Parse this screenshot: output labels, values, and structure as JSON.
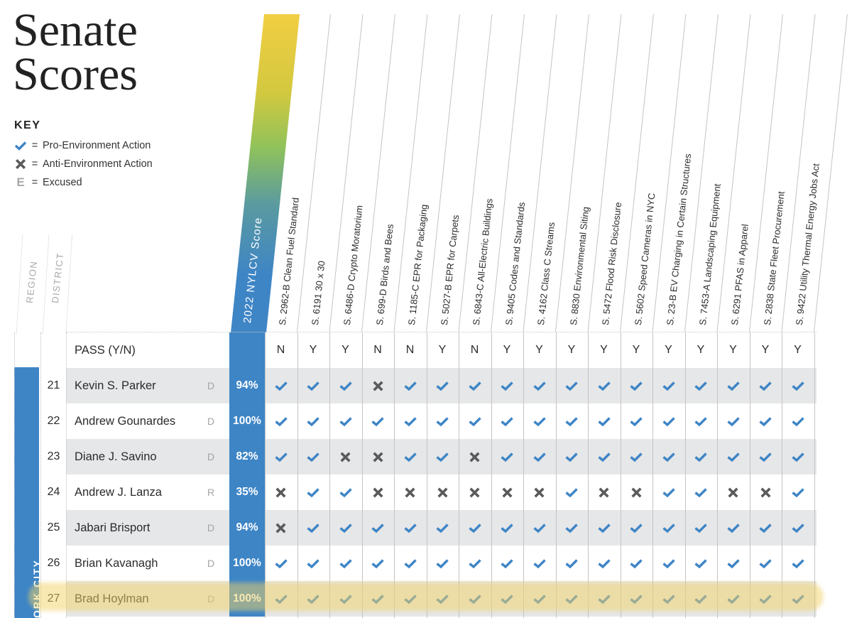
{
  "title": "Senate Scores",
  "title_lines": [
    "Senate",
    "Scores"
  ],
  "key": {
    "heading": "KEY",
    "items": [
      {
        "icon": "check-icon",
        "eq": "=",
        "label": "Pro-Environment Action"
      },
      {
        "icon": "cross-icon",
        "eq": "=",
        "label": "Anti-Environment Action"
      },
      {
        "icon": "excused-icon",
        "symbol": "E",
        "eq": "=",
        "label": "Excused"
      }
    ]
  },
  "columns": {
    "region": "REGION",
    "district": "DISTRICT",
    "score": "2022 NYLCV Score",
    "pass_label": "PASS (Y/N)"
  },
  "bills": [
    {
      "label": "S. 2962-B Clean Fuel Standard",
      "pass": "N"
    },
    {
      "label": "S. 6191 30 x 30",
      "pass": "Y"
    },
    {
      "label": "S. 6486-D Crypto Moratorium",
      "pass": "Y"
    },
    {
      "label": "S. 699-D Birds and Bees",
      "pass": "N"
    },
    {
      "label": "S. 1185-C EPR for Packaging",
      "pass": "N"
    },
    {
      "label": "S. 5027-B EPR for Carpets",
      "pass": "Y"
    },
    {
      "label": "S. 6843-C All-Electric Buildings",
      "pass": "N"
    },
    {
      "label": "S. 9405 Codes and Standards",
      "pass": "Y"
    },
    {
      "label": "S. 4162 Class C Streams",
      "pass": "Y"
    },
    {
      "label": "S. 8830 Environmental Siting",
      "pass": "Y"
    },
    {
      "label": "S. 5472 Flood Risk Disclosure",
      "pass": "Y"
    },
    {
      "label": "S. 5602 Speed Cameras in NYC",
      "pass": "Y"
    },
    {
      "label": "S. 23-B EV Charging in Certain Structures",
      "pass": "Y"
    },
    {
      "label": "S. 7453-A Landscaping Equipment",
      "pass": "Y"
    },
    {
      "label": "S. 6291 PFAS in Apparel",
      "pass": "Y"
    },
    {
      "label": "S. 2838 State Fleet Procurement",
      "pass": "Y"
    },
    {
      "label": "S. 9422 Utility Thermal Energy Jobs Act",
      "pass": "Y"
    }
  ],
  "region": {
    "label": "ORK CITY",
    "color": "#3e85c6"
  },
  "senators": [
    {
      "district": "21",
      "name": "Kevin S. Parker",
      "party": "D",
      "score": "94%",
      "votes": [
        "pro",
        "pro",
        "pro",
        "anti",
        "pro",
        "pro",
        "pro",
        "pro",
        "pro",
        "pro",
        "pro",
        "pro",
        "pro",
        "pro",
        "pro",
        "pro",
        "pro"
      ]
    },
    {
      "district": "22",
      "name": "Andrew Gounardes",
      "party": "D",
      "score": "100%",
      "votes": [
        "pro",
        "pro",
        "pro",
        "pro",
        "pro",
        "pro",
        "pro",
        "pro",
        "pro",
        "pro",
        "pro",
        "pro",
        "pro",
        "pro",
        "pro",
        "pro",
        "pro"
      ]
    },
    {
      "district": "23",
      "name": "Diane J. Savino",
      "party": "D",
      "score": "82%",
      "votes": [
        "pro",
        "pro",
        "anti",
        "anti",
        "pro",
        "pro",
        "anti",
        "pro",
        "pro",
        "pro",
        "pro",
        "pro",
        "pro",
        "pro",
        "pro",
        "pro",
        "pro"
      ]
    },
    {
      "district": "24",
      "name": "Andrew J. Lanza",
      "party": "R",
      "score": "35%",
      "votes": [
        "anti",
        "pro",
        "pro",
        "anti",
        "anti",
        "anti",
        "anti",
        "anti",
        "anti",
        "pro",
        "anti",
        "anti",
        "pro",
        "pro",
        "anti",
        "anti",
        "pro"
      ]
    },
    {
      "district": "25",
      "name": "Jabari Brisport",
      "party": "D",
      "score": "94%",
      "votes": [
        "anti",
        "pro",
        "pro",
        "pro",
        "pro",
        "pro",
        "pro",
        "pro",
        "pro",
        "pro",
        "pro",
        "pro",
        "pro",
        "pro",
        "pro",
        "pro",
        "pro"
      ]
    },
    {
      "district": "26",
      "name": "Brian Kavanagh",
      "party": "D",
      "score": "100%",
      "votes": [
        "pro",
        "pro",
        "pro",
        "pro",
        "pro",
        "pro",
        "pro",
        "pro",
        "pro",
        "pro",
        "pro",
        "pro",
        "pro",
        "pro",
        "pro",
        "pro",
        "pro"
      ]
    },
    {
      "district": "27",
      "name": "Brad Hoylman",
      "party": "D",
      "score": "100%",
      "highlighted": true,
      "votes": [
        "pro",
        "pro",
        "pro",
        "pro",
        "pro",
        "pro",
        "pro",
        "pro",
        "pro",
        "pro",
        "pro",
        "pro",
        "pro",
        "pro",
        "pro",
        "pro",
        "pro"
      ]
    }
  ],
  "colors": {
    "pro": "#3e85c6",
    "anti": "#5a5a5a",
    "excused": "#a8a8a8",
    "row_alt": "#e6e7e8",
    "highlight": "#f2d264",
    "gradient_top": "#f2ce42",
    "gradient_bottom": "#3e85c6"
  }
}
